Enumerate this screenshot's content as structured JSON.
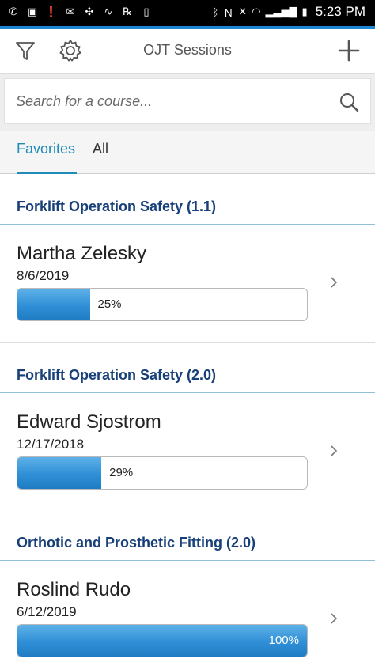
{
  "status_bar": {
    "time": "5:23 PM"
  },
  "header": {
    "title": "OJT Sessions"
  },
  "search": {
    "placeholder": "Search for a course..."
  },
  "tabs": [
    {
      "label": "Favorites",
      "active": true
    },
    {
      "label": "All",
      "active": false
    }
  ],
  "courses": [
    {
      "title": "Forklift Operation Safety (1.1)",
      "sessions": [
        {
          "name": "Martha Zelesky",
          "date": "8/6/2019",
          "progress": 25,
          "progress_label": "25%"
        }
      ]
    },
    {
      "title": "Forklift Operation Safety (2.0)",
      "sessions": [
        {
          "name": "Edward Sjostrom",
          "date": "12/17/2018",
          "progress": 29,
          "progress_label": "29%"
        }
      ]
    },
    {
      "title": "Orthotic and Prosthetic Fitting (2.0)",
      "sessions": [
        {
          "name": "Roslind Rudo",
          "date": "6/12/2019",
          "progress": 100,
          "progress_label": "100%"
        }
      ]
    }
  ],
  "colors": {
    "accent": "#1f86d3",
    "tab_active": "#1f8bb6",
    "section_title": "#173f78",
    "progress_fill": "#2f8fd6"
  }
}
